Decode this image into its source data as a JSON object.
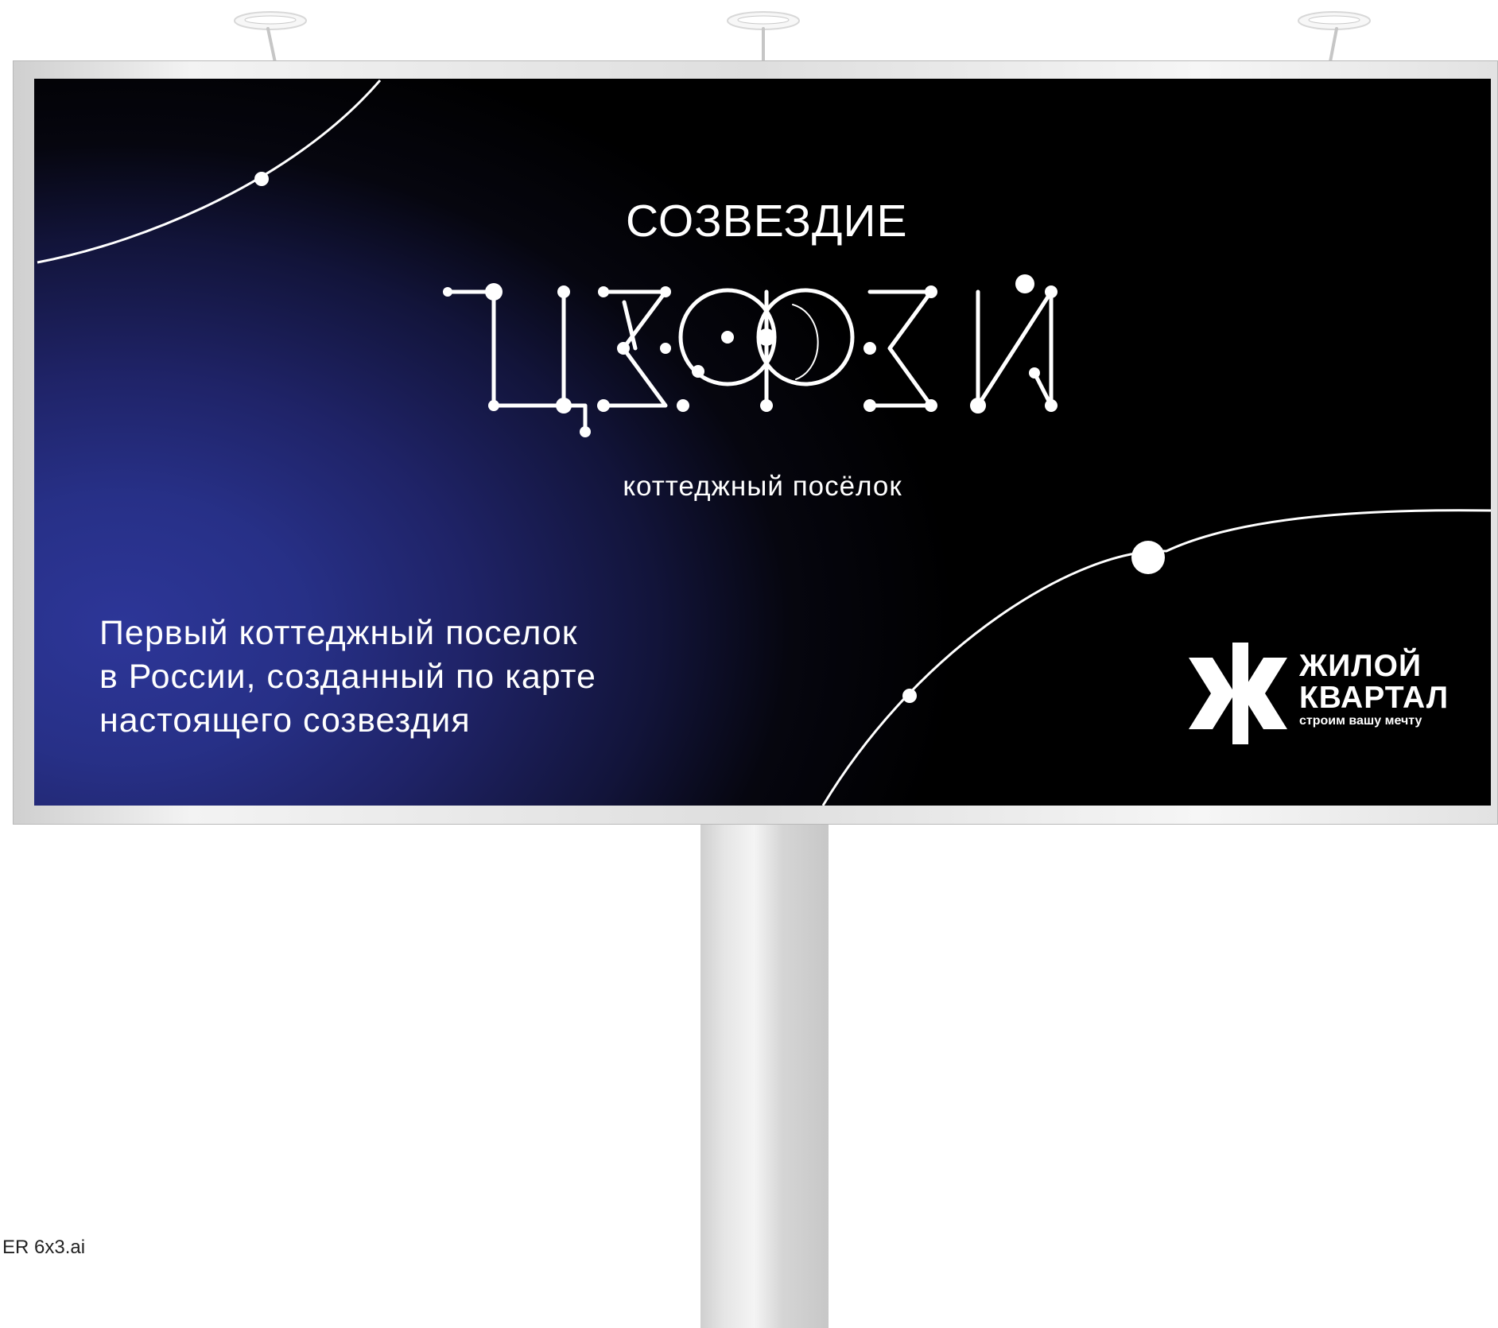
{
  "billboard": {
    "kicker": "СОЗВЕЗДИЕ",
    "wordmark": "ЦЕФЕЙ",
    "subtitle": "коттеджный посёлок",
    "campaign_lines": [
      "Первый коттеджный поселок",
      "в России, созданный по карте",
      "настоящего созвездия"
    ],
    "colors": {
      "deep_space": "#000000",
      "nebula_blue": "#2d3698",
      "line_white": "#ffffff"
    }
  },
  "developer_logo": {
    "name_line_1": "ЖИЛОЙ",
    "name_line_2": "КВАРТАЛ",
    "tagline": "строим вашу мечту",
    "mark_icon": "zh-k-logo-icon"
  },
  "footer": {
    "file_label": "ER 6x3.ai"
  },
  "icons": [
    "spotlight-icon",
    "constellation-wordmark-icon",
    "orbit-line-icon",
    "star-dot-icon",
    "zh-k-logo-icon"
  ]
}
